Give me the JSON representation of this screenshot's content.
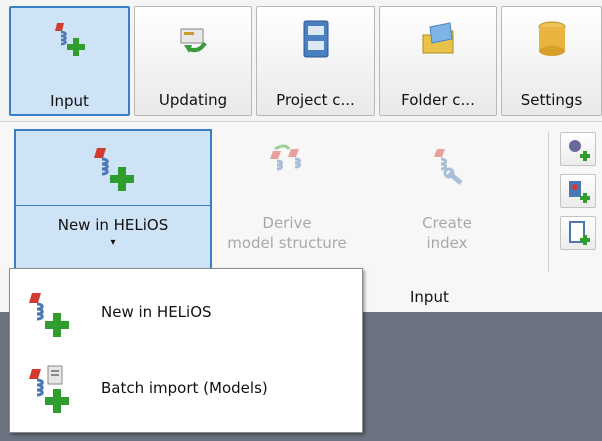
{
  "tabs": [
    {
      "label": "Input",
      "icon": "input-model-icon",
      "active": true
    },
    {
      "label": "Updating",
      "icon": "updating-icon",
      "active": false
    },
    {
      "label": "Project c...",
      "icon": "project-cabinet-icon",
      "active": false
    },
    {
      "label": "Folder c...",
      "icon": "folder-icon",
      "active": false
    },
    {
      "label": "Settings",
      "icon": "settings-database-icon",
      "active": false
    }
  ],
  "ribbon": {
    "new_in_helios": {
      "label": "New in HELiOS",
      "arrow": "▾",
      "icon": "new-model-icon"
    },
    "derive": {
      "line1": "Derive",
      "line2": "model structure",
      "icon": "derive-structure-icon",
      "disabled": true
    },
    "create_index": {
      "line1": "Create",
      "line2": "index",
      "icon": "create-index-icon",
      "disabled": true
    },
    "group_label": "Input"
  },
  "menu": {
    "items": [
      {
        "label": "New in HELiOS",
        "icon": "new-model-icon"
      },
      {
        "label": "Batch import (Models)",
        "icon": "batch-import-icon"
      }
    ]
  },
  "colors": {
    "active_fill": "#cfe3f7",
    "active_border": "#3a7ec4",
    "disabled_text": "#a9a9a9",
    "plus_green": "#2f9e2f"
  }
}
